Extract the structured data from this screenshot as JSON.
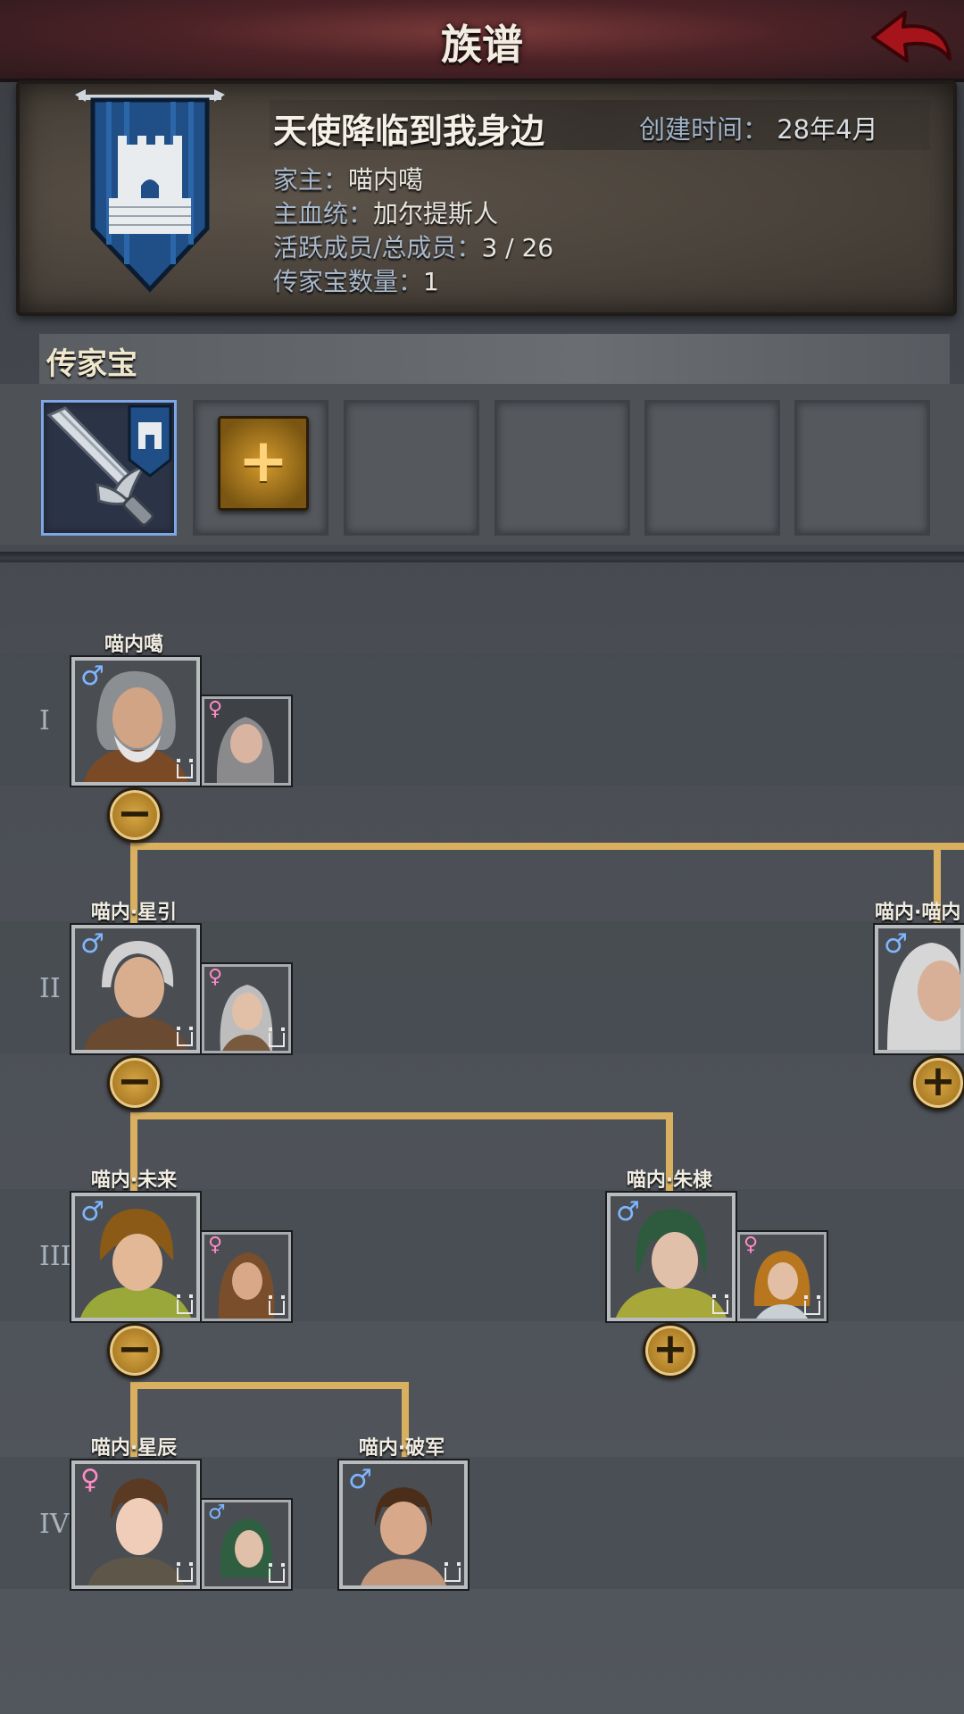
{
  "header": {
    "title": "族谱",
    "back_icon": "back-arrow-icon"
  },
  "clan": {
    "name": "天使降临到我身边",
    "created_label": "创建时间：",
    "created_value": "28年4月",
    "head_label": "家主：",
    "head_value": "喵内噶",
    "bloodline_label": "主血统：",
    "bloodline_value": "加尔提斯人",
    "members_label": "活跃成员/总成员：",
    "members_value": "3 / 26",
    "heirloom_count_label": "传家宝数量：",
    "heirloom_count_value": "1",
    "crest_icon": "castle-tower-banner-icon",
    "crest_color": "#1f4f86"
  },
  "heirlooms": {
    "title": "传家宝",
    "add_label": "+",
    "slots": [
      "sword-heirloom-icon",
      "add-slot",
      "empty",
      "empty",
      "empty",
      "empty"
    ]
  },
  "tree": {
    "generations": [
      "I",
      "II",
      "III",
      "IV"
    ],
    "people": [
      {
        "name": "喵内噶",
        "gender": "♂",
        "generation": "I"
      },
      {
        "name": "喵内·星引",
        "gender": "♂",
        "generation": "II"
      },
      {
        "name": "喵内·喵内",
        "gender": "♂",
        "generation": "II"
      },
      {
        "name": "喵内·未来",
        "gender": "♂",
        "generation": "III"
      },
      {
        "name": "喵内·朱棣",
        "gender": "♂",
        "generation": "III"
      },
      {
        "name": "喵内·星辰",
        "gender": "♀",
        "generation": "IV"
      },
      {
        "name": "喵内·破军",
        "gender": "♂",
        "generation": "IV"
      }
    ],
    "spouses": [
      {
        "gender": "♀"
      },
      {
        "gender": "♀"
      },
      {
        "gender": "♀"
      },
      {
        "gender": "♀"
      },
      {
        "gender": "♂"
      }
    ],
    "collapse_label": "−",
    "expand_label": "+",
    "line_color": "#d8b060"
  }
}
